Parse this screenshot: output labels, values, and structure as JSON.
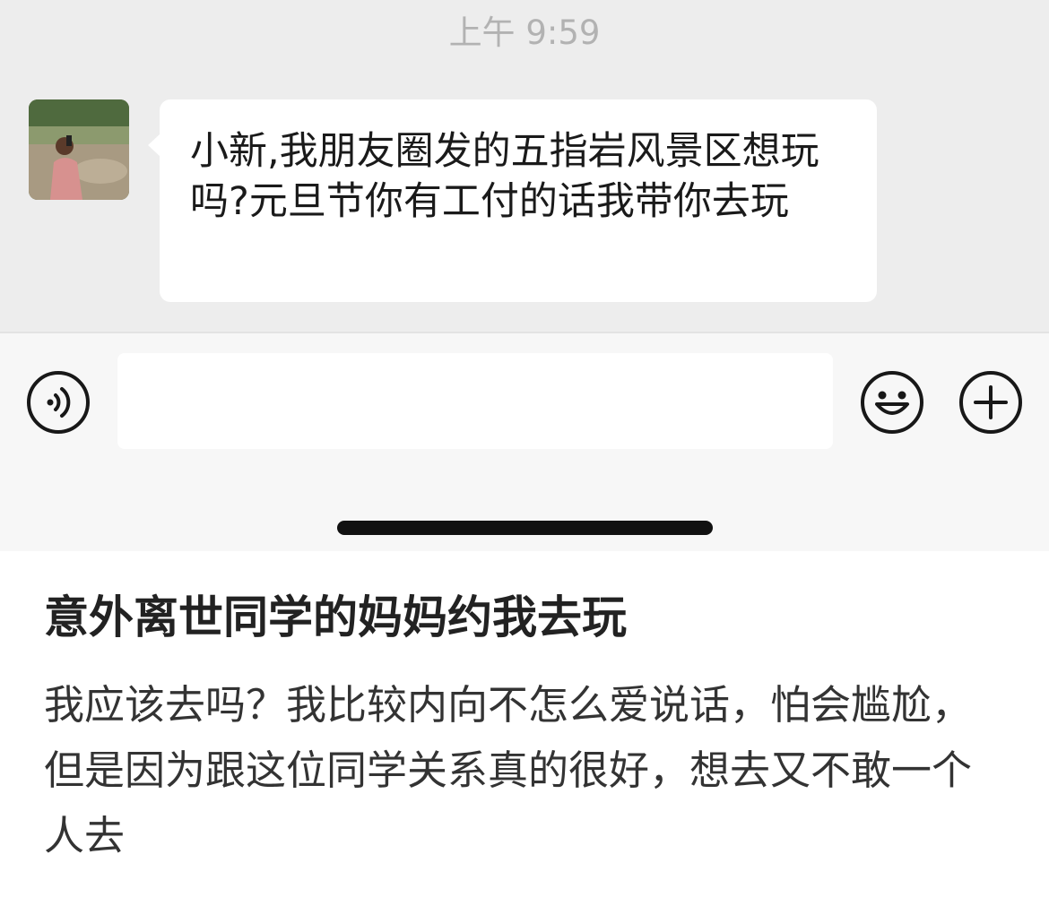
{
  "chat": {
    "timestamp": "上午 9:59",
    "message": {
      "text": "小新,我朋友圈发的五指岩风景区想玩吗?元旦节你有工付的话我带你去玩"
    }
  },
  "input_bar": {
    "voice_icon": "voice-input-icon",
    "text_value": "",
    "emoji_icon": "emoji-smiley-icon",
    "plus_icon": "plus-circle-icon"
  },
  "post": {
    "title": "意外离世同学的妈妈约我去玩",
    "body": "我应该去吗？我比较内向不怎么爱说话，怕会尴尬，但是因为跟这位同学关系真的很好，想去又不敢一个人去"
  },
  "colors": {
    "chat_background": "#ededed",
    "bubble": "#ffffff",
    "timestamp": "#b2b2b2",
    "input_bar": "#f7f7f7"
  }
}
